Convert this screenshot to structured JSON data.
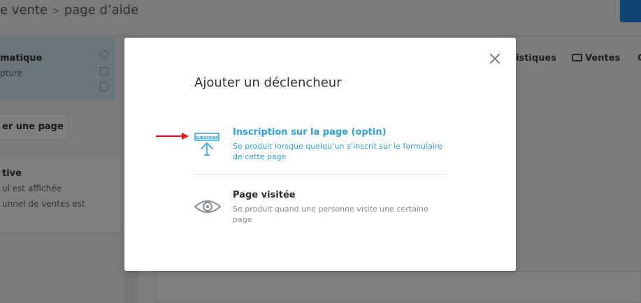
{
  "background": {
    "breadcrumb": {
      "part1": "e vente",
      "separator": ">",
      "part2": "page d’aide"
    },
    "sidebar": {
      "auto_card": {
        "title": "matique",
        "subtitle": "pture"
      },
      "add_page_button": "er une page",
      "active_card": {
        "title": "tive",
        "line1": "ul est affichée",
        "line2": "unnel de ventes est"
      }
    },
    "tabs": [
      {
        "label": "istiques"
      },
      {
        "label": "Ventes"
      },
      {
        "label": "C"
      }
    ]
  },
  "modal": {
    "title": "Ajouter un déclencheur",
    "close_icon": "close-icon",
    "options": [
      {
        "icon": "subscribe-icon",
        "icon_text": "SUBSCRIBE",
        "label": "Inscription sur la page (optin)",
        "description": "Se produit lorsque quelqu’un s’inscrit sur le formulaire de cette page",
        "color": "#2ba3e5"
      },
      {
        "icon": "eye-icon",
        "label": "Page visitée",
        "description": "Se produit quand une personne visite une certaine page",
        "color": "#2b2b2b"
      }
    ]
  },
  "colors": {
    "accent": "#2ba3e5",
    "annotation_arrow": "#e8141b",
    "overlay": "rgba(0,0,0,0.5)"
  }
}
